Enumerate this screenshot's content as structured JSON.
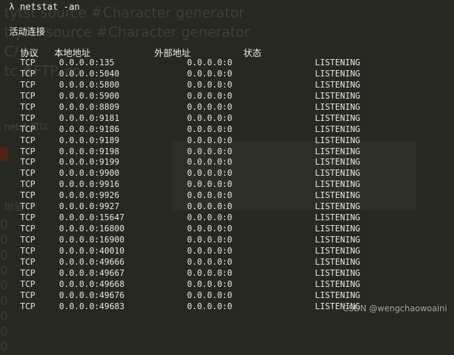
{
  "background_ghost": {
    "line1": "tytst source          #Character generator",
    "line2": "ttytst source          #Character generator",
    "line3": "C/      ta",
    "line4": "tc                   #FTP. co",
    "line5": "        netst                       可以",
    "line6": "",
    "line7": "                                    地址",
    "line8": "0\n0\n0\n0\n0\n0\n0\n0\n0"
  },
  "terminal": {
    "prompt": "λ netstat -an",
    "heading": "活动连接",
    "columns": {
      "proto": "协议",
      "local": "本地地址",
      "foreign": "外部地址",
      "state": "状态"
    },
    "rows": [
      {
        "proto": "TCP",
        "local": "0.0.0.0:135",
        "foreign": "0.0.0.0:0",
        "state": "LISTENING"
      },
      {
        "proto": "TCP",
        "local": "0.0.0.0:5040",
        "foreign": "0.0.0.0:0",
        "state": "LISTENING"
      },
      {
        "proto": "TCP",
        "local": "0.0.0.0:5800",
        "foreign": "0.0.0.0:0",
        "state": "LISTENING"
      },
      {
        "proto": "TCP",
        "local": "0.0.0.0:5900",
        "foreign": "0.0.0.0:0",
        "state": "LISTENING"
      },
      {
        "proto": "TCP",
        "local": "0.0.0.0:8809",
        "foreign": "0.0.0.0:0",
        "state": "LISTENING"
      },
      {
        "proto": "TCP",
        "local": "0.0.0.0:9181",
        "foreign": "0.0.0.0:0",
        "state": "LISTENING"
      },
      {
        "proto": "TCP",
        "local": "0.0.0.0:9186",
        "foreign": "0.0.0.0:0",
        "state": "LISTENING"
      },
      {
        "proto": "TCP",
        "local": "0.0.0.0:9189",
        "foreign": "0.0.0.0:0",
        "state": "LISTENING"
      },
      {
        "proto": "TCP",
        "local": "0.0.0.0:9198",
        "foreign": "0.0.0.0:0",
        "state": "LISTENING"
      },
      {
        "proto": "TCP",
        "local": "0.0.0.0:9199",
        "foreign": "0.0.0.0:0",
        "state": "LISTENING"
      },
      {
        "proto": "TCP",
        "local": "0.0.0.0:9900",
        "foreign": "0.0.0.0:0",
        "state": "LISTENING"
      },
      {
        "proto": "TCP",
        "local": "0.0.0.0:9916",
        "foreign": "0.0.0.0:0",
        "state": "LISTENING"
      },
      {
        "proto": "TCP",
        "local": "0.0.0.0:9926",
        "foreign": "0.0.0.0:0",
        "state": "LISTENING"
      },
      {
        "proto": "TCP",
        "local": "0.0.0.0:9927",
        "foreign": "0.0.0.0:0",
        "state": "LISTENING"
      },
      {
        "proto": "TCP",
        "local": "0.0.0.0:15647",
        "foreign": "0.0.0.0:0",
        "state": "LISTENING"
      },
      {
        "proto": "TCP",
        "local": "0.0.0.0:16800",
        "foreign": "0.0.0.0:0",
        "state": "LISTENING"
      },
      {
        "proto": "TCP",
        "local": "0.0.0.0:16900",
        "foreign": "0.0.0.0:0",
        "state": "LISTENING"
      },
      {
        "proto": "TCP",
        "local": "0.0.0.0:40010",
        "foreign": "0.0.0.0:0",
        "state": "LISTENING"
      },
      {
        "proto": "TCP",
        "local": "0.0.0.0:49666",
        "foreign": "0.0.0.0:0",
        "state": "LISTENING"
      },
      {
        "proto": "TCP",
        "local": "0.0.0.0:49667",
        "foreign": "0.0.0.0:0",
        "state": "LISTENING"
      },
      {
        "proto": "TCP",
        "local": "0.0.0.0:49668",
        "foreign": "0.0.0.0:0",
        "state": "LISTENING"
      },
      {
        "proto": "TCP",
        "local": "0.0.0.0:49676",
        "foreign": "0.0.0.0:0",
        "state": "LISTENING"
      },
      {
        "proto": "TCP",
        "local": "0.0.0.0:49683",
        "foreign": "0.0.0.0:0",
        "state": "LISTENING"
      }
    ]
  },
  "watermark": "CSDN @wengchaowoaini",
  "colors": {
    "background": "#272822",
    "foreground": "#e8e8e2",
    "ghost": "#3e3f37"
  }
}
